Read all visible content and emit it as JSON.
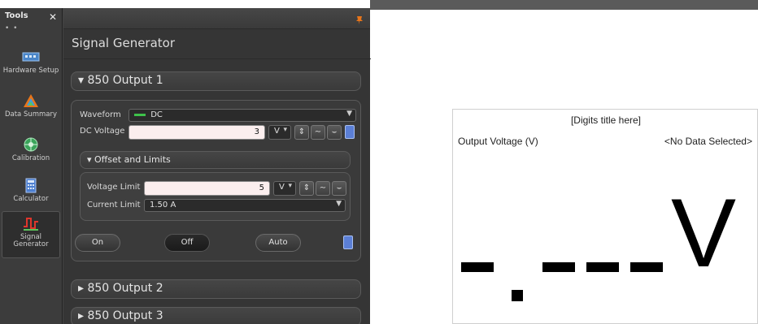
{
  "tools": {
    "title": "Tools",
    "close": "✕",
    "dots": "• •",
    "items": [
      {
        "label": "Hardware Setup",
        "icon": "hardware-setup-icon"
      },
      {
        "label": "Data Summary",
        "icon": "data-summary-icon"
      },
      {
        "label": "Calibration",
        "icon": "calibration-icon"
      },
      {
        "label": "Calculator",
        "icon": "calculator-icon"
      },
      {
        "label": "Signal Generator",
        "icon": "signal-generator-icon",
        "active": true
      }
    ]
  },
  "panel": {
    "title": "Signal Generator",
    "output1": {
      "header": "▾ 850 Output 1",
      "waveform_label": "Waveform",
      "waveform_value": "DC",
      "dc_voltage_label": "DC Voltage",
      "dc_voltage_value": "3",
      "unit": "V",
      "offset_header": "▾ Offset and Limits",
      "voltage_limit_label": "Voltage Limit",
      "voltage_limit_value": "5",
      "current_limit_label": "Current Limit",
      "current_limit_value": "1.50 A",
      "on_label": "On",
      "off_label": "Off",
      "auto_label": "Auto"
    },
    "output2": {
      "header": "▸ 850 Output 2"
    },
    "output3": {
      "header": "▸ 850 Output 3"
    }
  },
  "digits": {
    "title": "[Digits title here]",
    "measurement": "Output Voltage (V)",
    "selection": "<No Data Selected>",
    "unit_big": "V"
  },
  "colors": {
    "panel_bg": "#353535",
    "tools_bg": "#3c3c3c",
    "field_bg": "#fbeeee",
    "accent_orange": "#e8751a"
  }
}
